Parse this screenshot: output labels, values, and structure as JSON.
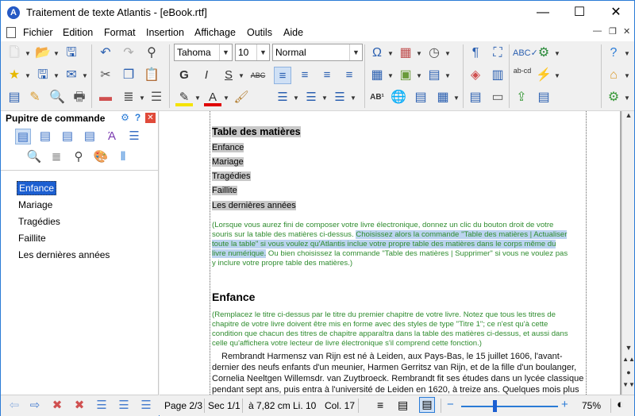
{
  "window": {
    "title": "Traitement de texte Atlantis - [eBook.rtf]",
    "app_icon": "A",
    "minimize": "—",
    "maximize": "☐",
    "close": "✕"
  },
  "menu": {
    "items": [
      "Fichier",
      "Edition",
      "Format",
      "Insertion",
      "Affichage",
      "Outils",
      "Aide"
    ]
  },
  "toolbar": {
    "font_name": "Tahoma",
    "font_size": "10",
    "style": "Normal",
    "bold": "G",
    "italic": "I",
    "underline": "S",
    "strike": "ABC",
    "superscript": "AB¹",
    "abcd": "ab-cd"
  },
  "panel": {
    "title": "Pupitre de commande",
    "toc": [
      "Enfance",
      "Mariage",
      "Tragédies",
      "Faillite",
      "Les dernières années"
    ],
    "selected": "Enfance"
  },
  "document": {
    "toc_heading": "Table des matières",
    "toc_entries": [
      "Enfance",
      "Mariage",
      "Tragédies",
      "Faillite",
      "Les dernières années"
    ],
    "note1_a": "(Lorsque vous aurez fini de composer votre livre électronique, donnez un clic du bouton droit de votre",
    "note1_b": "souris sur la table des matières ci-dessus. ",
    "note1_b_sel": "Choisissez alors la commande \"Table des matières | Actualiser",
    "note1_c_sel": "toute la table\" si vous voulez qu'Atlantis inclue votre propre table des matières dans le corps même du",
    "note1_d_sel": "livre numérique.",
    "note1_d": " Ou bien choisissez la commande \"Table des matières | Supprimer\" si vous ne voulez pas",
    "note1_e": "y inclure votre propre table des matières.)",
    "heading1": "Enfance",
    "note2_a": "(Remplacez le titre ci-dessus par le titre du premier chapitre de votre livre. Notez que tous les titres de",
    "note2_b": "chapitre de votre livre doivent être mis en forme avec des styles de type \"Titre 1\"; ce n'est qu'à cette",
    "note2_c": "condition que chacun des titres de chapitre apparaîtra dans la table des matières ci-dessus, et aussi dans",
    "note2_d": "celle qu'affichera votre lecteur de livre électronique s'il comprend cette fonction.)",
    "body_a": "Rembrandt Harmensz van Rijn est né à Leiden, aux Pays-Bas, le 15 juillet 1606, l'avant-",
    "body_b": "dernier des neufs enfants d'un meunier, Harmen Gerritsz van Rijn, et de la fille d'un boulanger,",
    "body_c": "Cornelia Neeltgen Willemsdr. van Zuytbroeck. Rembrandt fit ses études dans un lycée classique",
    "body_d": "pendant sept ans, puis entra à l'université de Leiden en 1620, à treize ans. Quelques mois plus"
  },
  "status": {
    "page": "Page 2/3",
    "section": "Sec 1/1",
    "position": "à 7,82 cm",
    "line": "Li. 10",
    "column": "Col. 17",
    "zoom": "75%"
  },
  "colors": {
    "accent": "#2b7bd6",
    "selection": "#1c5fd1",
    "note_green": "#2f8c2f"
  }
}
